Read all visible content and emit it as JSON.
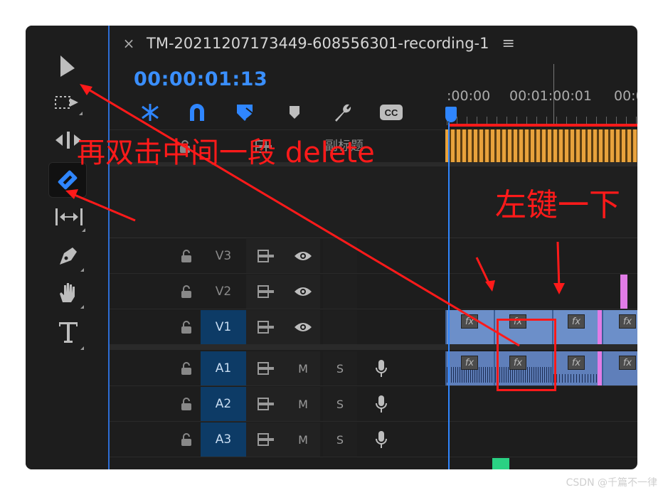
{
  "sequence": {
    "tab_title": "TM-20211207173449-608556301-recording-1",
    "close_glyph": "×",
    "menu_glyph": "≡",
    "timecode": "00:00:01:13"
  },
  "ruler": {
    "labels": [
      ":00:00",
      "00:01:00:01",
      "00:0"
    ]
  },
  "captions_track": {
    "label": "副标题"
  },
  "video_tracks": [
    {
      "name": "V3",
      "selected": false
    },
    {
      "name": "V2",
      "selected": false
    },
    {
      "name": "V1",
      "selected": true
    }
  ],
  "audio_tracks": [
    {
      "name": "A1",
      "selected": true,
      "mute": "M",
      "solo": "S"
    },
    {
      "name": "A2",
      "selected": true,
      "mute": "M",
      "solo": "S"
    },
    {
      "name": "A3",
      "selected": true,
      "mute": "M",
      "solo": "S"
    }
  ],
  "tools": [
    "selection-tool",
    "track-select-tool",
    "ripple-edit-tool",
    "razor-tool",
    "slip-tool",
    "pen-tool",
    "hand-tool",
    "type-tool"
  ],
  "timeline_buttons": [
    "snap-icon",
    "linked-selection-icon",
    "add-marker-icon",
    "marker-icon",
    "settings-wrench-icon",
    "captions-cc-icon"
  ],
  "clips": {
    "fx_label": "fx"
  },
  "annotations": {
    "double_click_text": "再双击中间一段 delete",
    "left_click_text": "左键一下"
  },
  "watermark": "CSDN @千篇不一律",
  "colors": {
    "accent": "#3a8fff",
    "annotation": "#ff1a1a",
    "clip": "#6c8fc9",
    "track_selected": "#0d3b66"
  }
}
